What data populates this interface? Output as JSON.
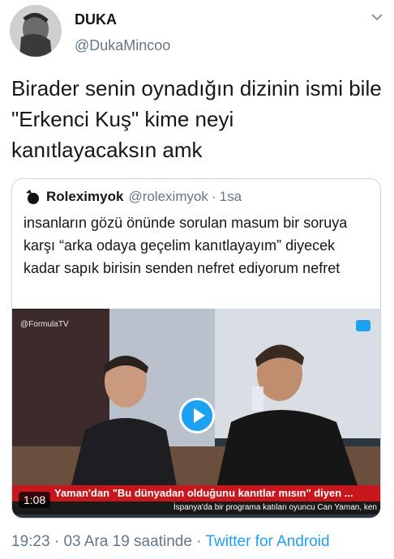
{
  "author": {
    "display_name": "DUKA",
    "handle": "@DukaMincoo",
    "avatar_icon": "avatar-photo",
    "menu_icon": "chevron-down-icon"
  },
  "tweet": {
    "text": "Birader senin oynadığın dizinin ismi bile \"Erkenci Kuş\" kime neyi kanıtlayacaksın amk"
  },
  "quoted_tweet": {
    "display_name": "Roleximyok",
    "handle": "@roleximyok",
    "separator": "·",
    "time": "1sa",
    "text": "insanların gözü önünde sorulan masum bir soruya karşı “arka odaya geçelim kanıtlayayım” diyecek kadar sapık birisin senden nefret ediyorum nefret",
    "video": {
      "watermark": "@FormulaTV",
      "ticker": "Yaman'dan \"Bu dünyadan olduğunu kanıtlar mısın\" diyen ...",
      "subticker": "İspanya'da bir programa katılan oyuncu Can Yaman, ken",
      "duration": "1:08",
      "play_icon": "play-icon",
      "accent_color": "#1da1f2",
      "ticker_color": "#c8161d"
    }
  },
  "footer": {
    "time": "19:23",
    "sep1": " · ",
    "date": "03 Ara 19 saatinde",
    "sep2": " · ",
    "app": "Twitter for Android"
  },
  "colors": {
    "text": "#14171a",
    "secondary": "#657786",
    "link": "#1da1f2",
    "border": "#ccd6dd"
  }
}
